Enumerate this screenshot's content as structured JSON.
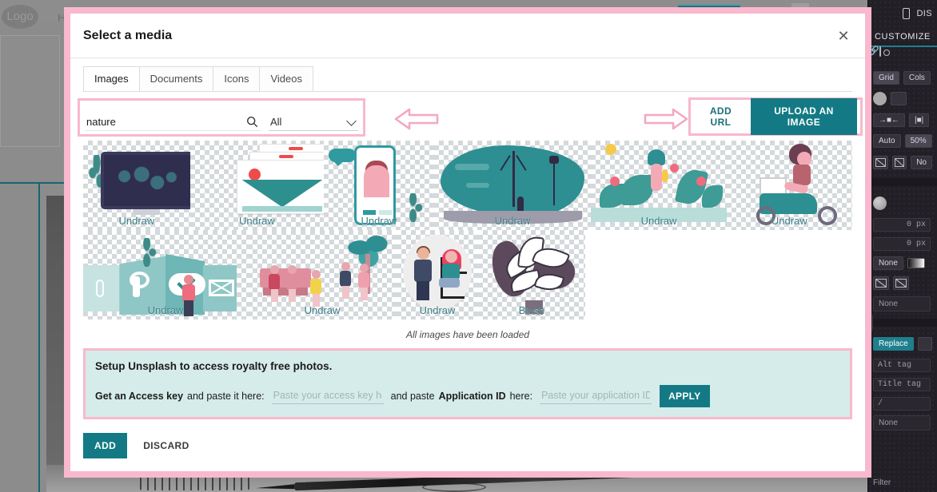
{
  "background": {
    "logo_text": "Logo",
    "menu_item": "H"
  },
  "right_panel": {
    "device_label": "DIS",
    "customize_label": "CUSTOMIZE",
    "grid_label": "Grid",
    "cols_label": "Cols",
    "auto_label": "Auto",
    "zoom_label": "50%",
    "none_label_1": "No",
    "px_value_1": "0 px",
    "px_value_2": "0 px",
    "none_label_2": "None",
    "none_label_3": "None",
    "replace_label": "Replace",
    "alt_tag_placeholder": "Alt tag",
    "title_tag_placeholder": "Title tag",
    "path_value": "/",
    "none_label_4": "None",
    "filter_label": "Filter"
  },
  "modal": {
    "title": "Select a media",
    "close_icon": "close-icon",
    "tabs": [
      {
        "label": "Images",
        "active": true
      },
      {
        "label": "Documents",
        "active": false
      },
      {
        "label": "Icons",
        "active": false
      },
      {
        "label": "Videos",
        "active": false
      }
    ],
    "search": {
      "value": "nature",
      "placeholder": "",
      "icon": "search-icon",
      "filter_selected": "All",
      "filter_options": [
        "All"
      ]
    },
    "actions": {
      "add_url_label": "ADD URL",
      "upload_label": "UPLOAD AN IMAGE"
    },
    "annotations": {
      "arrow_left": "arrow-left-icon",
      "arrow_right": "arrow-right-icon"
    },
    "grid": {
      "row1": [
        {
          "label": "Undraw",
          "art": "desktop-world-map"
        },
        {
          "label": "Undraw",
          "art": "image-card-stack"
        },
        {
          "label": "Undraw",
          "art": "phone-video-chat"
        },
        {
          "label": "Undraw",
          "art": "night-tree-scene"
        },
        {
          "label": "Undraw",
          "art": "flower-garden"
        },
        {
          "label": "Undraw",
          "art": "scooter-delivery"
        }
      ],
      "row2": [
        {
          "label": "Undraw",
          "art": "wall-icons-cloud"
        },
        {
          "label": "Undraw",
          "art": "park-bench-people"
        },
        {
          "label": "Undraw",
          "art": "chair-conversation"
        },
        {
          "label": "Blush",
          "art": "line-art-plant"
        }
      ],
      "footer_text": "All images have been loaded"
    },
    "unsplash": {
      "heading": "Setup Unsplash to access royalty free photos.",
      "link_label": "Get an Access key",
      "text_paste_here": "and paste it here:",
      "access_key_placeholder": "Paste your access key here",
      "text_and_paste": "and paste",
      "application_id_label": "Application ID",
      "text_here": "here:",
      "application_id_placeholder": "Paste your application ID here",
      "apply_label": "APPLY"
    },
    "footer": {
      "add_label": "ADD",
      "discard_label": "DISCARD"
    }
  },
  "colors": {
    "accent_teal": "#137a85",
    "annotation_pink": "#f9b8cd",
    "unsplash_bg": "#d5ecea",
    "label_teal": "#3e7e86"
  }
}
